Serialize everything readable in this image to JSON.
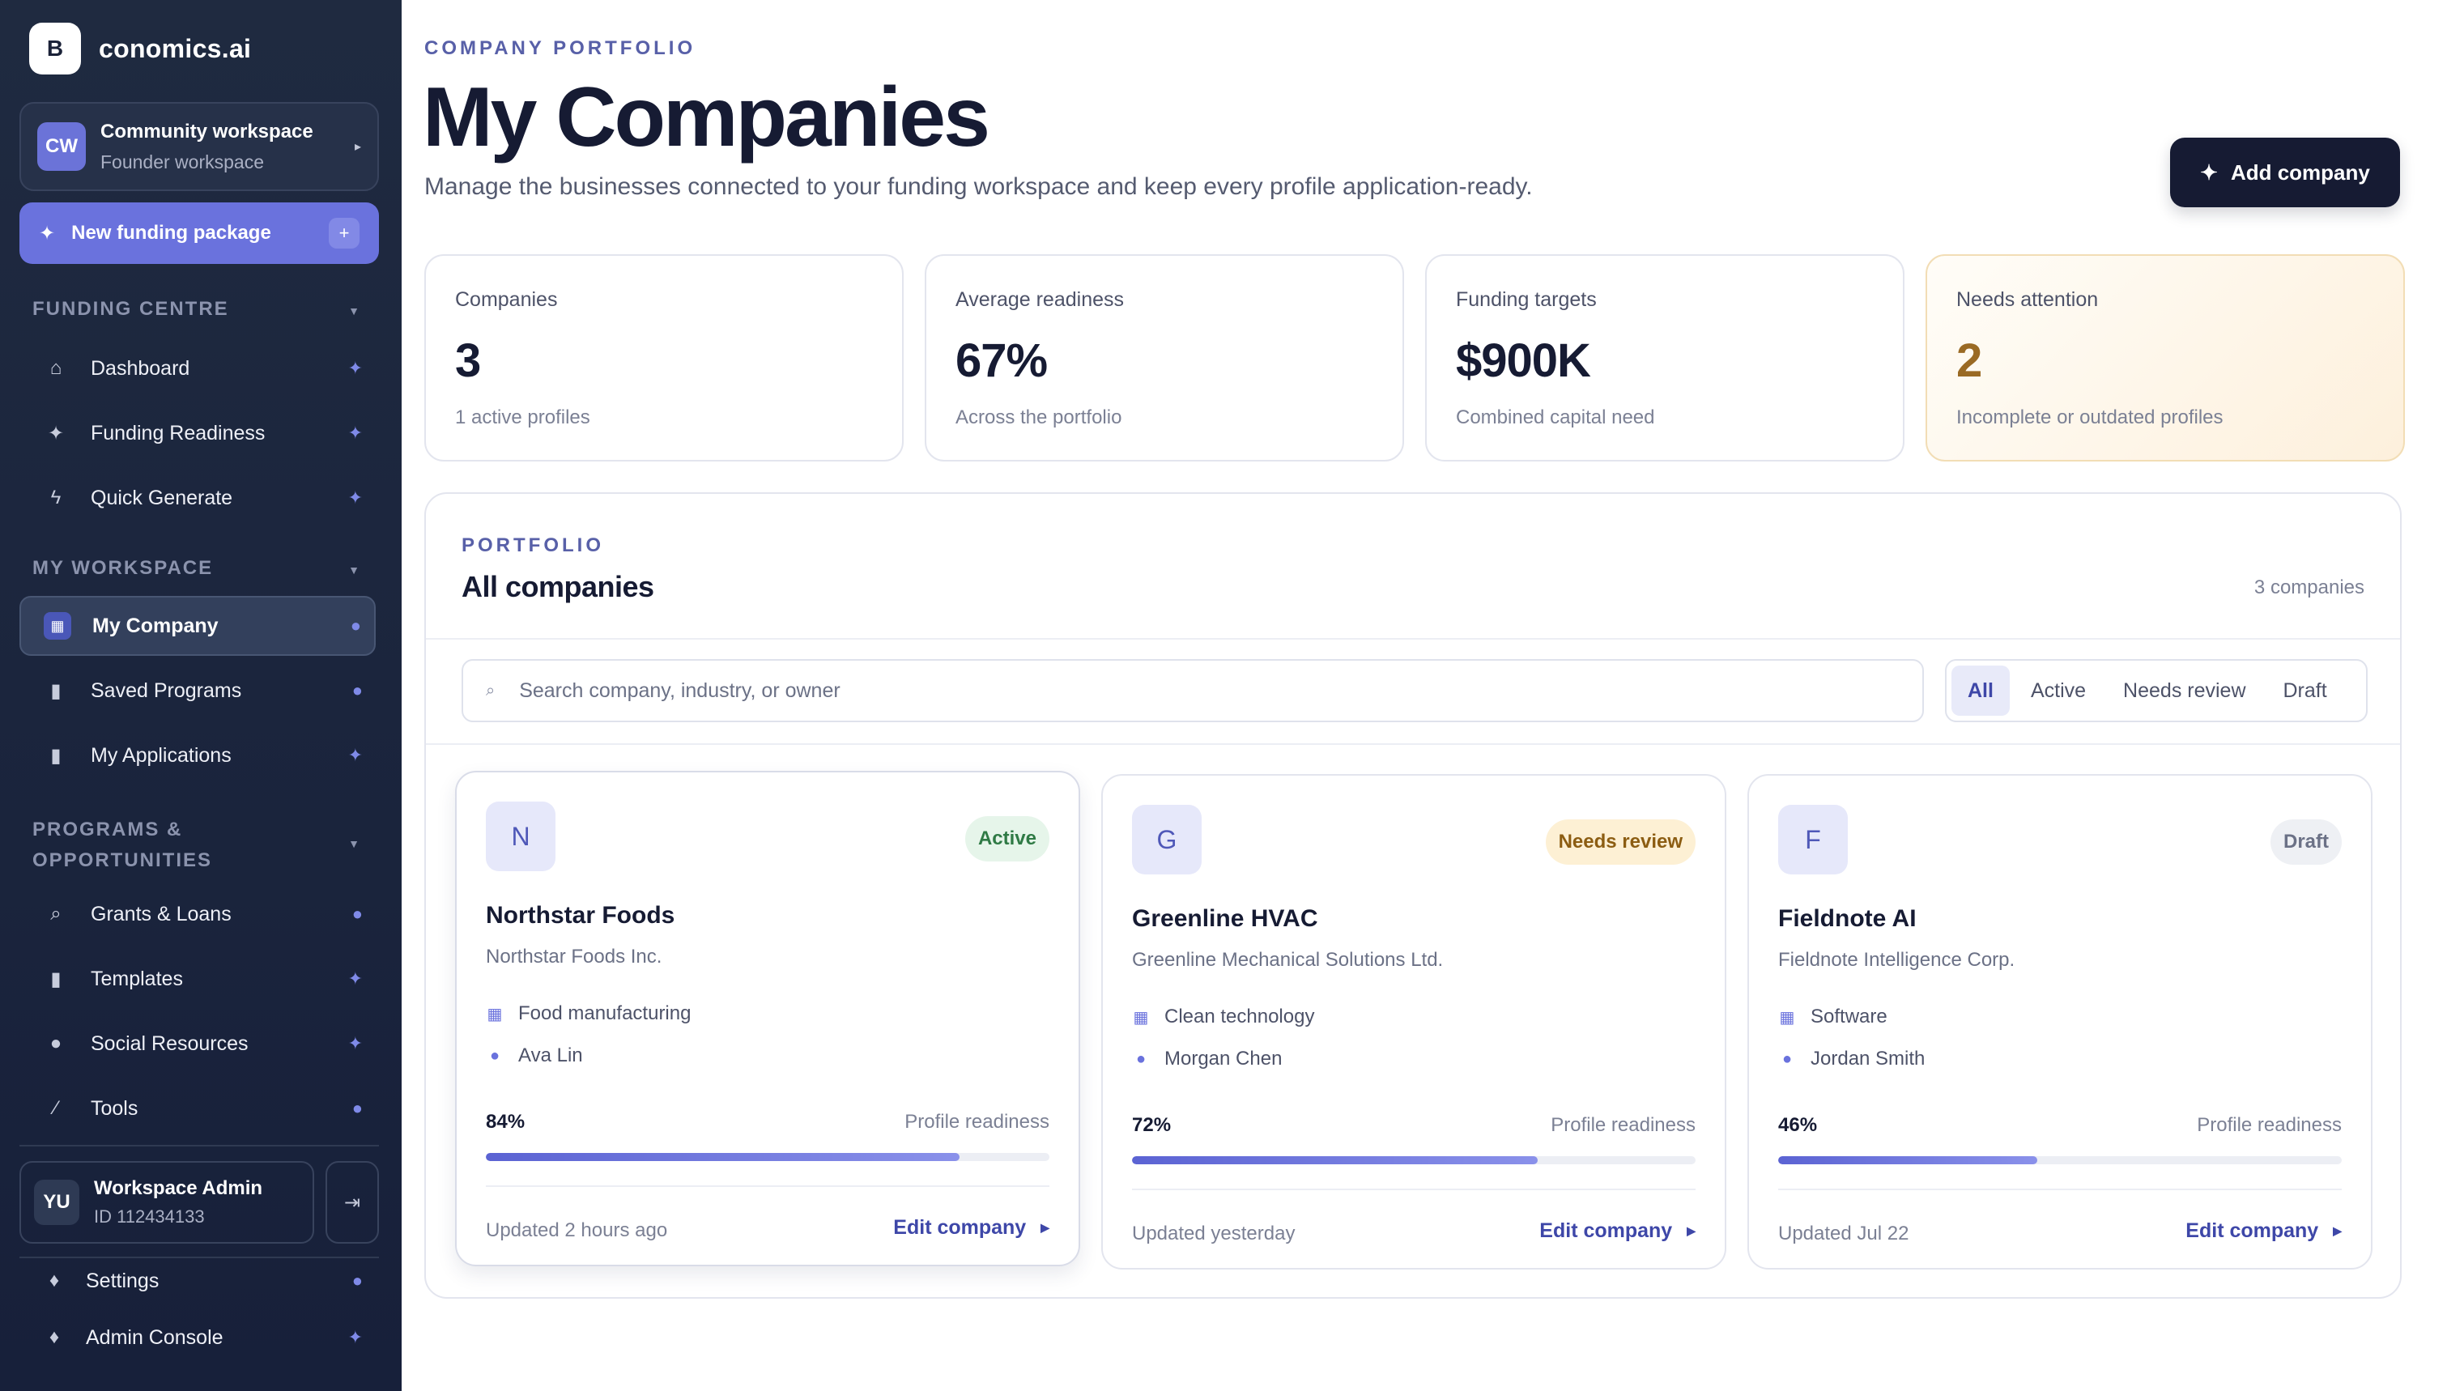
{
  "brand": {
    "logo_letter": "B",
    "name": "conomics.ai"
  },
  "workspace": {
    "initials": "CW",
    "name": "Community workspace",
    "type": "Founder workspace"
  },
  "new_funding": {
    "label": "New funding package",
    "plus": "+"
  },
  "sidebar": {
    "funding_centre": {
      "title": "FUNDING CENTRE",
      "items": [
        {
          "label": "Dashboard",
          "icon": "home-icon"
        },
        {
          "label": "Funding Readiness",
          "icon": "sparkle-icon"
        },
        {
          "label": "Quick Generate",
          "icon": "bolt-icon"
        }
      ]
    },
    "my_workspace": {
      "title": "MY WORKSPACE",
      "items": [
        {
          "label": "My Company",
          "icon": "grid-icon",
          "active": true
        },
        {
          "label": "Saved Programs",
          "icon": "document-icon"
        },
        {
          "label": "My Applications",
          "icon": "document-icon"
        }
      ]
    },
    "programs": {
      "title_line1": "PROGRAMS &",
      "title_line2": "OPPORTUNITIES",
      "items": [
        {
          "label": "Grants & Loans",
          "icon": "search-icon"
        },
        {
          "label": "Templates",
          "icon": "document-icon"
        },
        {
          "label": "Social Resources",
          "icon": "person-icon"
        },
        {
          "label": "Tools",
          "icon": "wand-icon"
        }
      ]
    },
    "admin": {
      "initials": "YU",
      "name": "Workspace Admin",
      "id": "ID 112434133"
    },
    "footer": [
      {
        "label": "Settings",
        "icon": "flask-icon"
      },
      {
        "label": "Admin Console",
        "icon": "flask-icon"
      }
    ]
  },
  "header": {
    "eyebrow": "COMPANY PORTFOLIO",
    "title": "My Companies",
    "lead": "Manage the businesses connected to your funding workspace and keep every profile application-ready.",
    "add_button": "Add company"
  },
  "stats": [
    {
      "label": "Companies",
      "value": "3",
      "sub": "1 active profiles"
    },
    {
      "label": "Average readiness",
      "value": "67%",
      "sub": "Across the portfolio"
    },
    {
      "label": "Funding targets",
      "value": "$900K",
      "sub": "Combined capital need"
    },
    {
      "label": "Needs attention",
      "value": "2",
      "sub": "Incomplete or outdated profiles"
    }
  ],
  "portfolio": {
    "eyebrow": "PORTFOLIO",
    "title": "All companies",
    "count": "3 companies",
    "search_placeholder": "Search company, industry, or owner",
    "filters": [
      "All",
      "Active",
      "Needs review",
      "Draft"
    ],
    "selected_filter": "All",
    "readiness_label": "Profile readiness",
    "edit_label": "Edit company",
    "companies": [
      {
        "initial": "N",
        "status": "Active",
        "name": "Northstar Foods",
        "legal": "Northstar Foods Inc.",
        "industry": "Food manufacturing",
        "owner": "Ava Lin",
        "readiness": 84,
        "readiness_text": "84%",
        "updated": "Updated 2 hours ago"
      },
      {
        "initial": "G",
        "status": "Needs review",
        "name": "Greenline HVAC",
        "legal": "Greenline Mechanical Solutions Ltd.",
        "industry": "Clean technology",
        "owner": "Morgan Chen",
        "readiness": 72,
        "readiness_text": "72%",
        "updated": "Updated yesterday"
      },
      {
        "initial": "F",
        "status": "Draft",
        "name": "Fieldnote AI",
        "legal": "Fieldnote Intelligence Corp.",
        "industry": "Software",
        "owner": "Jordan Smith",
        "readiness": 46,
        "readiness_text": "46%",
        "updated": "Updated Jul 22"
      }
    ]
  },
  "colors": {
    "sidebar": "#1f2a40",
    "accent": "#6a72dd",
    "primary_button": "#161b33",
    "attention": "#9a6a24"
  }
}
